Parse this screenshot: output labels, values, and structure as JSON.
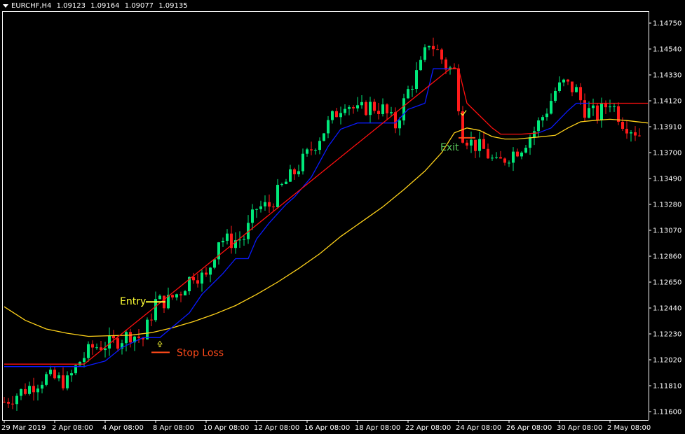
{
  "header": {
    "symbol": "EURCHF,H4",
    "open": "1.09123",
    "high": "1.09164",
    "low": "1.09077",
    "close": "1.09135"
  },
  "annotations": {
    "entry": "Entry",
    "exit": "Exit",
    "stop_loss": "Stop Loss"
  },
  "colors": {
    "background": "#000000",
    "bull": "#00e87a",
    "bear": "#ff1a1a",
    "trail_blue": "#0a1aff",
    "trail_red": "#ff0f0f",
    "ma_yellow": "#ffd21a",
    "entry": "#ffff33",
    "exit": "#5ac85a",
    "stop_loss": "#ff4a1a",
    "axis": "#ffffff"
  },
  "chart_data": {
    "type": "candlestick",
    "symbol": "EURCHF",
    "timeframe": "H4",
    "ylim": [
      1.1148,
      1.1486
    ],
    "y_ticks": [
      "1.14750",
      "1.14540",
      "1.14330",
      "1.14120",
      "1.13910",
      "1.13700",
      "1.13490",
      "1.13280",
      "1.13070",
      "1.12860",
      "1.12650",
      "1.12440",
      "1.12230",
      "1.12020",
      "1.11810",
      "1.11600"
    ],
    "x_ticks": [
      "29 Mar 2019",
      "2 Apr 08:00",
      "4 Apr 08:00",
      "8 Apr 08:00",
      "10 Apr 08:00",
      "12 Apr 08:00",
      "16 Apr 08:00",
      "18 Apr 08:00",
      "22 Apr 08:00",
      "24 Apr 08:00",
      "26 Apr 08:00",
      "30 Apr 08:00",
      "2 May 08:00"
    ],
    "x_tick_bars": [
      0,
      12,
      24,
      36,
      48,
      60,
      72,
      84,
      96,
      108,
      120,
      132,
      144
    ],
    "close_path": [
      [
        0,
        1.1168
      ],
      [
        5,
        1.1178
      ],
      [
        10,
        1.1188
      ],
      [
        15,
        1.1184
      ],
      [
        18,
        1.1201
      ],
      [
        21,
        1.1212
      ],
      [
        26,
        1.1216
      ],
      [
        30,
        1.1223
      ],
      [
        33,
        1.1219
      ],
      [
        36,
        1.1249
      ],
      [
        39,
        1.125
      ],
      [
        42,
        1.1258
      ],
      [
        45,
        1.1272
      ],
      [
        48,
        1.1268
      ],
      [
        51,
        1.13
      ],
      [
        54,
        1.1298
      ],
      [
        57,
        1.1301
      ],
      [
        60,
        1.1325
      ],
      [
        63,
        1.1327
      ],
      [
        66,
        1.1342
      ],
      [
        69,
        1.1354
      ],
      [
        72,
        1.1368
      ],
      [
        75,
        1.1383
      ],
      [
        78,
        1.1398
      ],
      [
        81,
        1.1412
      ],
      [
        84,
        1.1403
      ],
      [
        87,
        1.1408
      ],
      [
        90,
        1.1405
      ],
      [
        93,
        1.1392
      ],
      [
        96,
        1.142
      ],
      [
        99,
        1.144
      ],
      [
        101,
        1.146
      ],
      [
        103,
        1.1452
      ],
      [
        105,
        1.144
      ],
      [
        107,
        1.1436
      ],
      [
        109,
        1.1385
      ],
      [
        111,
        1.1378
      ],
      [
        114,
        1.1372
      ],
      [
        117,
        1.136
      ],
      [
        120,
        1.1368
      ],
      [
        123,
        1.1375
      ],
      [
        126,
        1.1388
      ],
      [
        129,
        1.1405
      ],
      [
        131,
        1.142
      ],
      [
        133,
        1.1426
      ],
      [
        136,
        1.142
      ],
      [
        138,
        1.1405
      ],
      [
        141,
        1.14
      ],
      [
        144,
        1.1412
      ],
      [
        147,
        1.1395
      ],
      [
        151,
        1.1385
      ]
    ],
    "trail_blue": [
      [
        0,
        1.11965
      ],
      [
        19,
        1.11965
      ],
      [
        24,
        1.1201
      ],
      [
        28,
        1.1212
      ],
      [
        33,
        1.122
      ],
      [
        37,
        1.122
      ],
      [
        44,
        1.124
      ],
      [
        47,
        1.1255
      ],
      [
        52,
        1.1272
      ],
      [
        55,
        1.1284
      ],
      [
        58,
        1.1284
      ],
      [
        60,
        1.13
      ],
      [
        63,
        1.1313
      ],
      [
        67,
        1.1328
      ],
      [
        69,
        1.1334
      ],
      [
        73,
        1.135
      ],
      [
        77,
        1.1375
      ],
      [
        80,
        1.1389
      ],
      [
        84,
        1.1394
      ],
      [
        93,
        1.1394
      ],
      [
        96,
        1.1405
      ],
      [
        100,
        1.141
      ],
      [
        102,
        1.1438
      ],
      [
        106,
        1.1438
      ]
    ],
    "trail_red": [
      [
        0,
        1.11985
      ],
      [
        19,
        1.11985
      ],
      [
        106,
        1.1438
      ],
      [
        108,
        1.1438
      ],
      [
        110,
        1.141
      ],
      [
        113,
        1.14
      ],
      [
        116,
        1.139
      ],
      [
        118,
        1.1385
      ],
      [
        123,
        1.1385
      ],
      [
        127,
        1.1386
      ]
    ],
    "trail_blue_2": [
      [
        127,
        1.1386
      ],
      [
        130,
        1.139
      ],
      [
        134,
        1.1404
      ],
      [
        136,
        1.141
      ],
      [
        139,
        1.141
      ]
    ],
    "trail_red_2": [
      [
        139,
        1.141
      ],
      [
        153,
        1.141
      ]
    ],
    "ma_yellow": [
      [
        0,
        1.1245
      ],
      [
        5,
        1.1234
      ],
      [
        10,
        1.1227
      ],
      [
        15,
        1.12235
      ],
      [
        20,
        1.1221
      ],
      [
        25,
        1.12215
      ],
      [
        30,
        1.1222
      ],
      [
        35,
        1.1224
      ],
      [
        40,
        1.1228
      ],
      [
        45,
        1.1233
      ],
      [
        50,
        1.1239
      ],
      [
        55,
        1.1246
      ],
      [
        60,
        1.1255
      ],
      [
        65,
        1.1265
      ],
      [
        70,
        1.1276
      ],
      [
        75,
        1.1288
      ],
      [
        80,
        1.1302
      ],
      [
        85,
        1.1314
      ],
      [
        90,
        1.1326
      ],
      [
        95,
        1.134
      ],
      [
        100,
        1.1355
      ],
      [
        104,
        1.137
      ],
      [
        107,
        1.1386
      ],
      [
        110,
        1.139
      ],
      [
        113,
        1.1388
      ],
      [
        116,
        1.1383
      ],
      [
        119,
        1.1381
      ],
      [
        122,
        1.1381
      ],
      [
        125,
        1.1382
      ],
      [
        128,
        1.1383
      ],
      [
        131,
        1.1384
      ],
      [
        134,
        1.139
      ],
      [
        137,
        1.1395
      ],
      [
        140,
        1.1396
      ],
      [
        144,
        1.1397
      ],
      [
        148,
        1.1396
      ],
      [
        153,
        1.1394
      ]
    ],
    "entry_marker": {
      "bar": 36,
      "price": 1.1249
    },
    "stop_loss_marker": {
      "bar": 36,
      "price": 1.1208
    },
    "exit_marker": {
      "bar": 111,
      "price": 1.1382
    },
    "exit_check": {
      "bar": 109,
      "price": 1.1402
    }
  }
}
